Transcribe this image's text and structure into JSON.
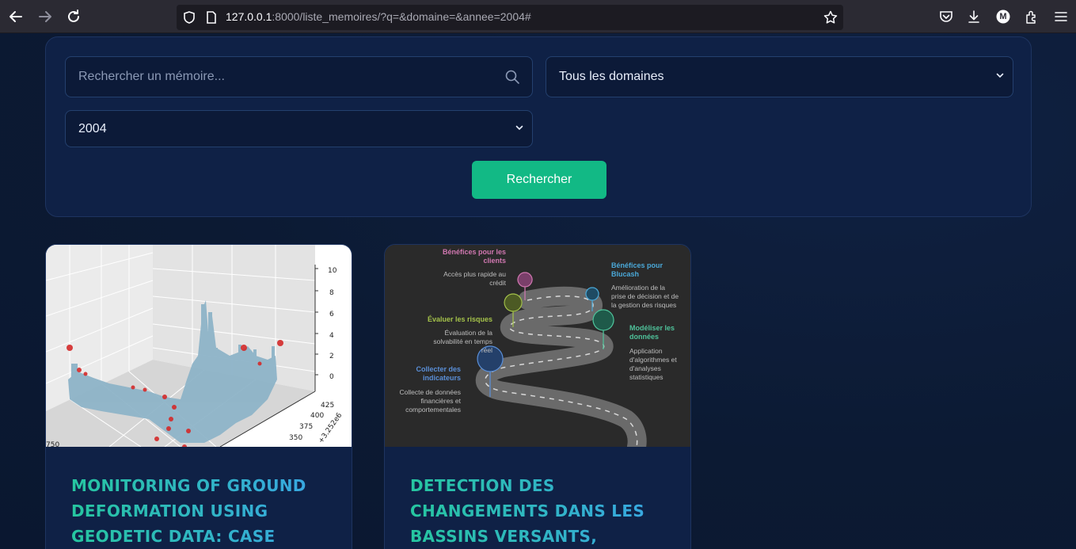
{
  "browser": {
    "url_host": "127.0.0.1",
    "url_rest": ":8000/liste_memoires/?q=&domaine=&annee=2004#",
    "back_icon": "back-arrow-icon",
    "forward_icon": "forward-arrow-icon",
    "reload_icon": "reload-icon",
    "account_initial": "M"
  },
  "search": {
    "placeholder": "Rechercher un mémoire...",
    "domain_selected": "Tous les domaines",
    "year_selected": "2004",
    "button_label": "Rechercher"
  },
  "cards": [
    {
      "title": "MONITORING OF GROUND DEFORMATION USING GEODETIC DATA: CASE",
      "image": "3d-scatter-plot",
      "plot": {
        "z_ticks": [
          "10",
          "8",
          "6",
          "4",
          "2",
          "0"
        ],
        "y_ticks": [
          "425",
          "400",
          "375",
          "350"
        ],
        "y_offset": "+3.252e6",
        "x_tick": "750"
      }
    },
    {
      "title": "DETECTION DES CHANGEMENTS DANS LES BASSINS VERSANTS,",
      "image": "roadmap-infographic",
      "infographic": {
        "benef_clients": "Bénéfices pour les clients",
        "benef_clients_desc": "Accès plus rapide au crédit",
        "benef_blucash": "Bénéfices pour Blucash",
        "benef_blucash_desc": "Amélioration de la prise de décision et de la gestion des risques",
        "evaluer": "Évaluer les risques",
        "evaluer_desc": "Évaluation de la solvabilité en temps réel",
        "modeliser": "Modéliser les données",
        "modeliser_desc": "Application d'algorithmes et d'analyses statistiques",
        "collecter": "Collecter des indicateurs",
        "collecter_desc": "Collecte de données financières et comportementales"
      }
    }
  ],
  "colors": {
    "page_bg": "#0c1a33",
    "panel_bg": "#0f2146",
    "accent_green": "#12b985",
    "title_gradient_start": "#26c6a0",
    "title_gradient_end": "#3aa5e8"
  }
}
